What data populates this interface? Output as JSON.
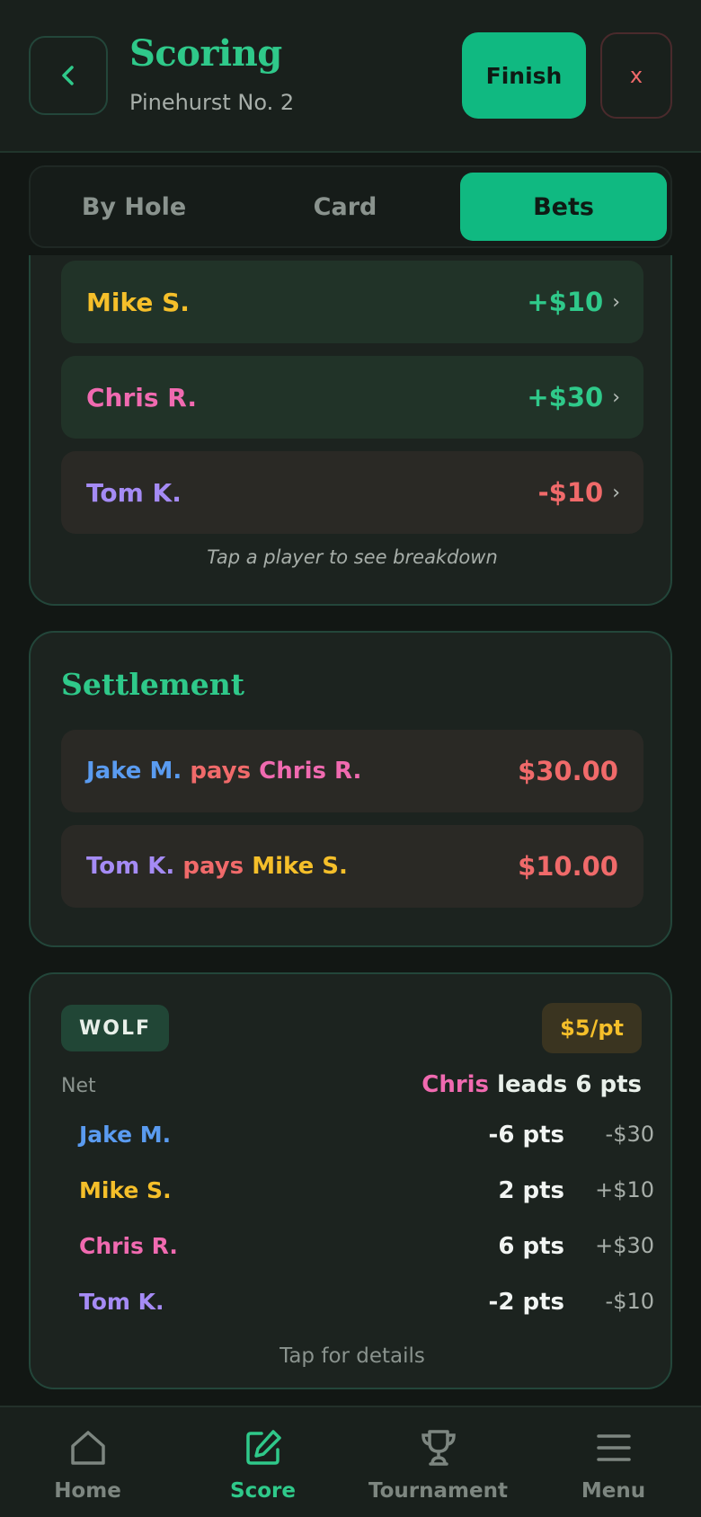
{
  "header": {
    "title": "Scoring",
    "subtitle": "Pinehurst No. 2",
    "finish_label": "Finish",
    "close_label": "x"
  },
  "tabs": [
    {
      "label": "By Hole",
      "active": false
    },
    {
      "label": "Card",
      "active": false
    },
    {
      "label": "Bets",
      "active": true
    }
  ],
  "totals": {
    "players": [
      {
        "name": "Mike S.",
        "amount": "+$10",
        "color": "#f5bf2a",
        "sign": "pos"
      },
      {
        "name": "Chris R.",
        "amount": "+$30",
        "color": "#f06ab0",
        "sign": "pos"
      },
      {
        "name": "Tom K.",
        "amount": "-$10",
        "color": "#a58bf5",
        "sign": "neg"
      }
    ],
    "hint": "Tap a player to see breakdown"
  },
  "settlement": {
    "title": "Settlement",
    "pays_word": "pays",
    "rows": [
      {
        "from": "Jake M.",
        "to": "Chris R.",
        "amount": "$30.00"
      },
      {
        "from": "Tom K.",
        "to": "Mike S.",
        "amount": "$10.00"
      }
    ]
  },
  "wolf": {
    "badge": "WOLF",
    "rate": "$5/pt",
    "net_label": "Net",
    "leader_name": "Chris",
    "leader_text": "leads 6 pts",
    "rows": [
      {
        "name": "Jake M.",
        "pts": "-6 pts",
        "money": "-$30"
      },
      {
        "name": "Mike S.",
        "pts": "2 pts",
        "money": "+$10"
      },
      {
        "name": "Chris R.",
        "pts": "6 pts",
        "money": "+$30"
      },
      {
        "name": "Tom K.",
        "pts": "-2 pts",
        "money": "-$10"
      }
    ],
    "hint": "Tap for details"
  },
  "nav": [
    {
      "label": "Home",
      "icon": "home-icon",
      "active": false
    },
    {
      "label": "Score",
      "icon": "edit-icon",
      "active": true
    },
    {
      "label": "Tournament",
      "icon": "trophy-icon",
      "active": false
    },
    {
      "label": "Menu",
      "icon": "menu-icon",
      "active": false
    }
  ],
  "colors": {
    "accent": "#10b981",
    "jake": "#5a9bf0",
    "mike": "#f5bf2a",
    "chris": "#f06ab0",
    "tom": "#a58bf5",
    "negative": "#f06a6a"
  }
}
